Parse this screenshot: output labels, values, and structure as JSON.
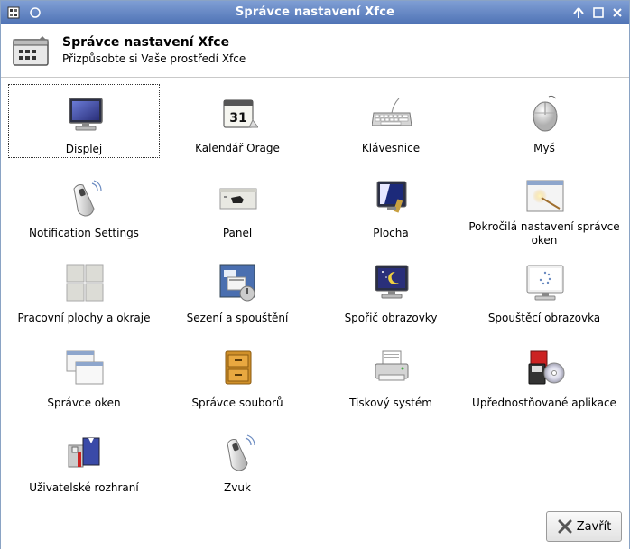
{
  "window": {
    "title": "Správce nastavení Xfce"
  },
  "header": {
    "title": "Správce nastavení Xfce",
    "subtitle": "Přizpůsobte si Vaše prostředí Xfce"
  },
  "items": [
    {
      "label": "Displej",
      "icon": "monitor-icon"
    },
    {
      "label": "Kalendář Orage",
      "icon": "calendar-icon"
    },
    {
      "label": "Klávesnice",
      "icon": "keyboard-icon"
    },
    {
      "label": "Myš",
      "icon": "mouse-icon"
    },
    {
      "label": "Notification Settings",
      "icon": "notification-icon"
    },
    {
      "label": "Panel",
      "icon": "panel-icon"
    },
    {
      "label": "Plocha",
      "icon": "desktop-icon"
    },
    {
      "label": "Pokročilá nastavení správce oken",
      "icon": "window-manager-tweaks-icon"
    },
    {
      "label": "Pracovní plochy a okraje",
      "icon": "workspaces-icon"
    },
    {
      "label": "Sezení a spouštění",
      "icon": "session-icon"
    },
    {
      "label": "Spořič obrazovky",
      "icon": "screensaver-icon"
    },
    {
      "label": "Spouštěcí obrazovka",
      "icon": "splash-icon"
    },
    {
      "label": "Správce oken",
      "icon": "window-manager-icon"
    },
    {
      "label": "Správce souborů",
      "icon": "file-manager-icon"
    },
    {
      "label": "Tiskový systém",
      "icon": "printer-icon"
    },
    {
      "label": "Upřednostňované aplikace",
      "icon": "preferred-apps-icon"
    },
    {
      "label": "Uživatelské rozhraní",
      "icon": "user-interface-icon"
    },
    {
      "label": "Zvuk",
      "icon": "sound-icon"
    }
  ],
  "close_button": {
    "label": "Zavřít"
  },
  "colors": {
    "titlebar": "#5f82c4",
    "focus": "#333333"
  }
}
